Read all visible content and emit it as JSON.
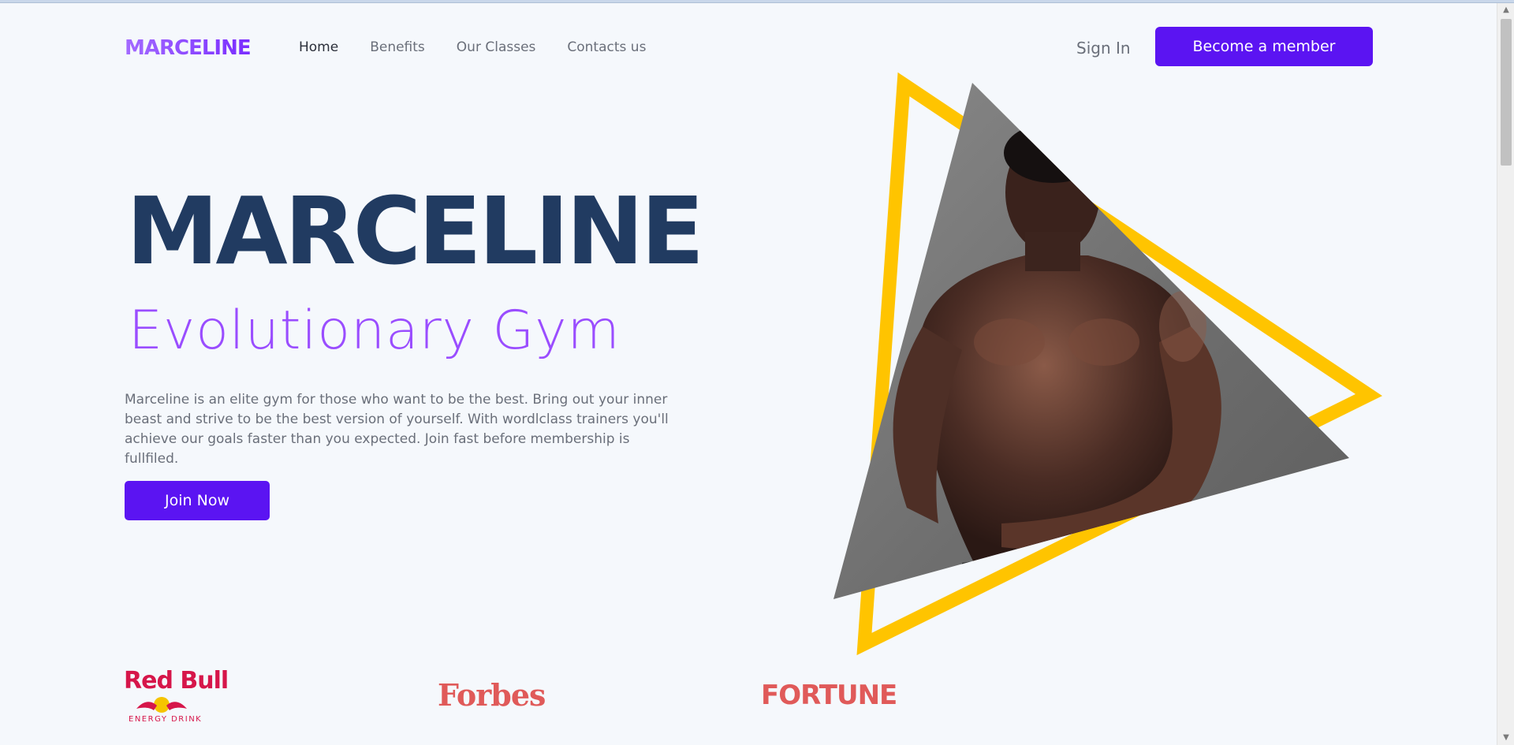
{
  "brand": {
    "logo_small": "MARCELINE"
  },
  "nav": {
    "items": [
      {
        "label": "Home",
        "active": true
      },
      {
        "label": "Benefits",
        "active": false
      },
      {
        "label": "Our Classes",
        "active": false
      },
      {
        "label": "Contacts us",
        "active": false
      }
    ],
    "sign_in": "Sign In",
    "cta": "Become a member"
  },
  "hero": {
    "title": "MARCELINE",
    "subtitle": "Evolutionary Gym",
    "description": "Marceline is an elite gym for those who want to be the best. Bring out your inner beast and strive to be the best version of yourself. With wordlclass trainers you'll achieve our goals faster than you expected. Join fast before membership is fullfiled.",
    "join_button": "Join Now"
  },
  "logos": {
    "redbull_main": "Red Bull",
    "redbull_sub": "ENERGY DRINK",
    "forbes": "Forbes",
    "fortune": "FORTUNE"
  },
  "colors": {
    "primary": "#5b14f2",
    "title_navy": "#213b61",
    "subtitle_purple": "#9a4dff",
    "accent_yellow": "#ffc400",
    "brand_red": "#e05a59"
  },
  "icons": {
    "scroll_up": "triangle-up-icon",
    "scroll_down": "triangle-down-icon"
  }
}
